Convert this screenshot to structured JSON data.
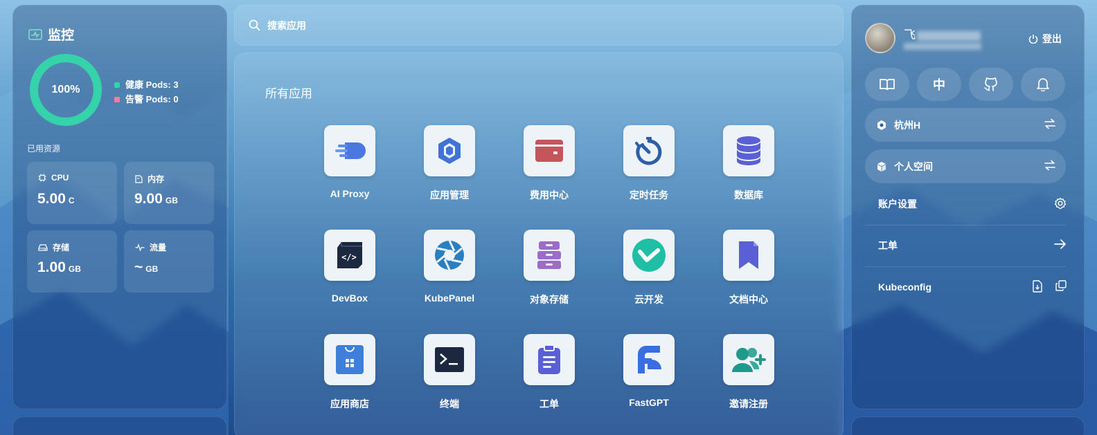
{
  "monitor": {
    "title": "监控",
    "health_percent": 100,
    "health_text": "100%",
    "healthy_pods": "健康 Pods: 3",
    "alert_pods": "告警 Pods: 0",
    "used_resources": "已用资源",
    "cpu": {
      "label": "CPU",
      "value": "5.00",
      "unit": "C"
    },
    "memory": {
      "label": "内存",
      "value": "9.00",
      "unit": "GB"
    },
    "storage": {
      "label": "存储",
      "value": "1.00",
      "unit": "GB"
    },
    "traffic": {
      "label": "流量",
      "value": "~",
      "unit": "GB"
    },
    "colors": {
      "healthy": "#34d3aa",
      "alert": "#ff7c9c"
    }
  },
  "search": {
    "placeholder": "搜索应用",
    "icon": "search-icon"
  },
  "apps": {
    "heading": "所有应用",
    "items": [
      {
        "label": "AI Proxy",
        "icon": "ai-proxy-icon"
      },
      {
        "label": "应用管理",
        "icon": "app-manage-icon"
      },
      {
        "label": "费用中心",
        "icon": "wallet-icon"
      },
      {
        "label": "定时任务",
        "icon": "timer-icon"
      },
      {
        "label": "数据库",
        "icon": "database-icon"
      },
      {
        "label": "DevBox",
        "icon": "devbox-icon"
      },
      {
        "label": "KubePanel",
        "icon": "kubepanel-icon"
      },
      {
        "label": "对象存储",
        "icon": "cabinet-icon"
      },
      {
        "label": "云开发",
        "icon": "cloud-dev-icon"
      },
      {
        "label": "文档中心",
        "icon": "bookmark-icon"
      },
      {
        "label": "应用商店",
        "icon": "store-bag-icon"
      },
      {
        "label": "终端",
        "icon": "terminal-icon"
      },
      {
        "label": "工单",
        "icon": "clipboard-icon"
      },
      {
        "label": "FastGPT",
        "icon": "fastgpt-icon"
      },
      {
        "label": "邀请注册",
        "icon": "invite-user-icon"
      }
    ]
  },
  "account": {
    "username_visible": "飞",
    "logout": "登出",
    "quick_buttons": [
      {
        "name": "docs-book-icon",
        "text": ""
      },
      {
        "name": "language-button",
        "text": "中"
      },
      {
        "name": "github-icon",
        "text": ""
      },
      {
        "name": "bell-icon",
        "text": ""
      }
    ],
    "region": "杭州H",
    "workspace": "个人空间",
    "menu": {
      "settings": "账户设置",
      "ticket": "工单",
      "kubeconfig": "Kubeconfig"
    }
  }
}
